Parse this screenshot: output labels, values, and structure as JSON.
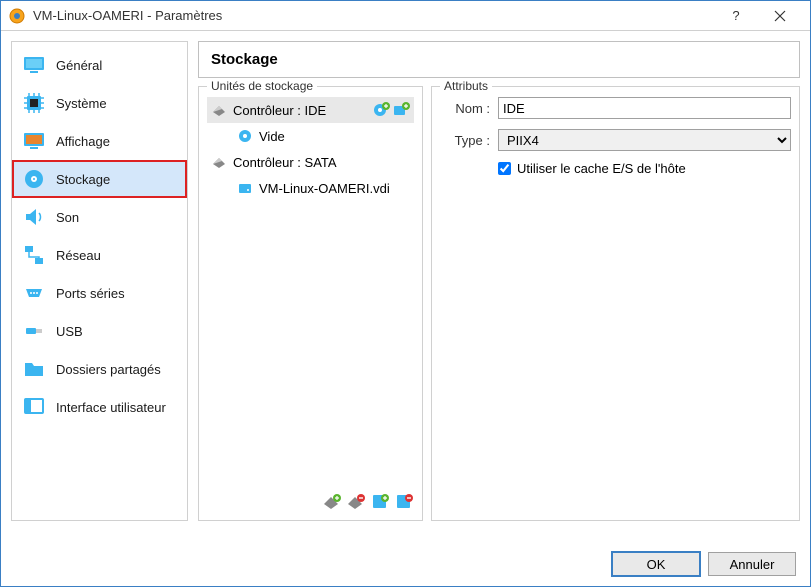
{
  "window": {
    "title": "VM-Linux-OAMERI - Paramètres"
  },
  "sidebar": {
    "items": [
      {
        "label": "Général"
      },
      {
        "label": "Système"
      },
      {
        "label": "Affichage"
      },
      {
        "label": "Stockage"
      },
      {
        "label": "Son"
      },
      {
        "label": "Réseau"
      },
      {
        "label": "Ports séries"
      },
      {
        "label": "USB"
      },
      {
        "label": "Dossiers partagés"
      },
      {
        "label": "Interface utilisateur"
      }
    ]
  },
  "page": {
    "title": "Stockage"
  },
  "storage_units": {
    "legend": "Unités de stockage",
    "controllers": [
      {
        "label": "Contrôleur : IDE",
        "selected": true,
        "children": [
          {
            "label": "Vide"
          }
        ]
      },
      {
        "label": "Contrôleur : SATA",
        "selected": false,
        "children": [
          {
            "label": "VM-Linux-OAMERI.vdi"
          }
        ]
      }
    ]
  },
  "attributes": {
    "legend": "Attributs",
    "name_label": "Nom :",
    "name_value": "IDE",
    "type_label": "Type :",
    "type_value": "PIIX4",
    "host_cache_label": "Utiliser le cache E/S de l'hôte",
    "host_cache_checked": true
  },
  "buttons": {
    "ok": "OK",
    "cancel": "Annuler"
  }
}
